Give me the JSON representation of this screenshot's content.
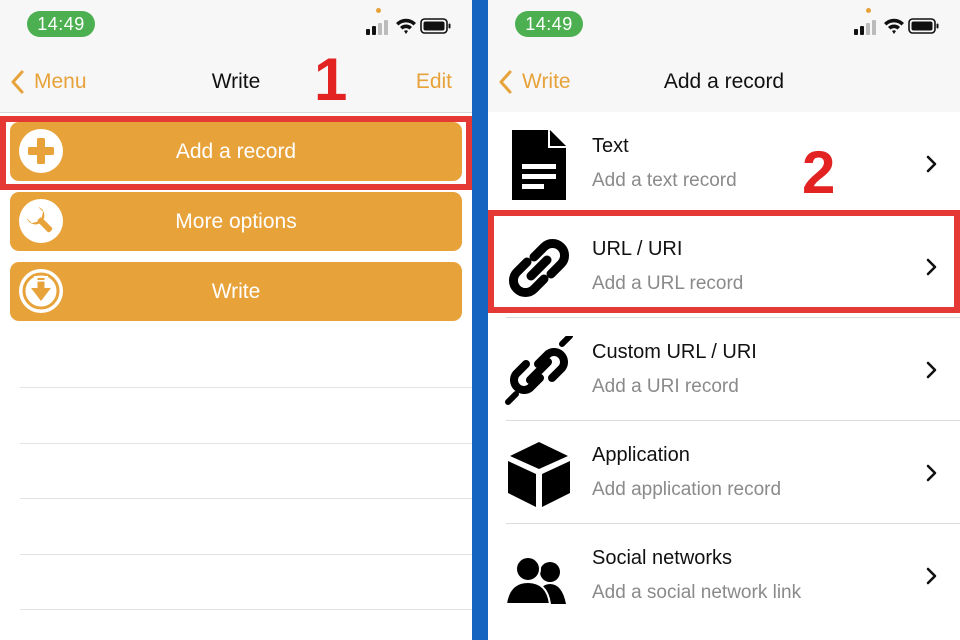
{
  "left": {
    "status": {
      "time": "14:49"
    },
    "nav": {
      "back_label": "Menu",
      "title": "Write",
      "right_label": "Edit"
    },
    "actions": [
      {
        "label": "Add a record",
        "icon": "plus-circle-icon"
      },
      {
        "label": "More options",
        "icon": "wrench-icon"
      },
      {
        "label": "Write",
        "icon": "download-circle-icon"
      }
    ],
    "step_number": "1"
  },
  "right": {
    "status": {
      "time": "14:49"
    },
    "nav": {
      "back_label": "Write",
      "title": "Add a record"
    },
    "records": [
      {
        "title": "Text",
        "subtitle": "Add a text record",
        "icon": "document-icon"
      },
      {
        "title": "URL / URI",
        "subtitle": "Add a URL record",
        "icon": "link-icon"
      },
      {
        "title": "Custom URL / URI",
        "subtitle": "Add a URI record",
        "icon": "broken-link-icon"
      },
      {
        "title": "Application",
        "subtitle": "Add application record",
        "icon": "cube-icon"
      },
      {
        "title": "Social networks",
        "subtitle": "Add a social network link",
        "icon": "users-icon"
      }
    ],
    "step_number": "2"
  },
  "colors": {
    "accent": "#e8a23a",
    "highlight": "#e53935",
    "pill": "#4caf50",
    "divider_strip": "#1565c0"
  }
}
